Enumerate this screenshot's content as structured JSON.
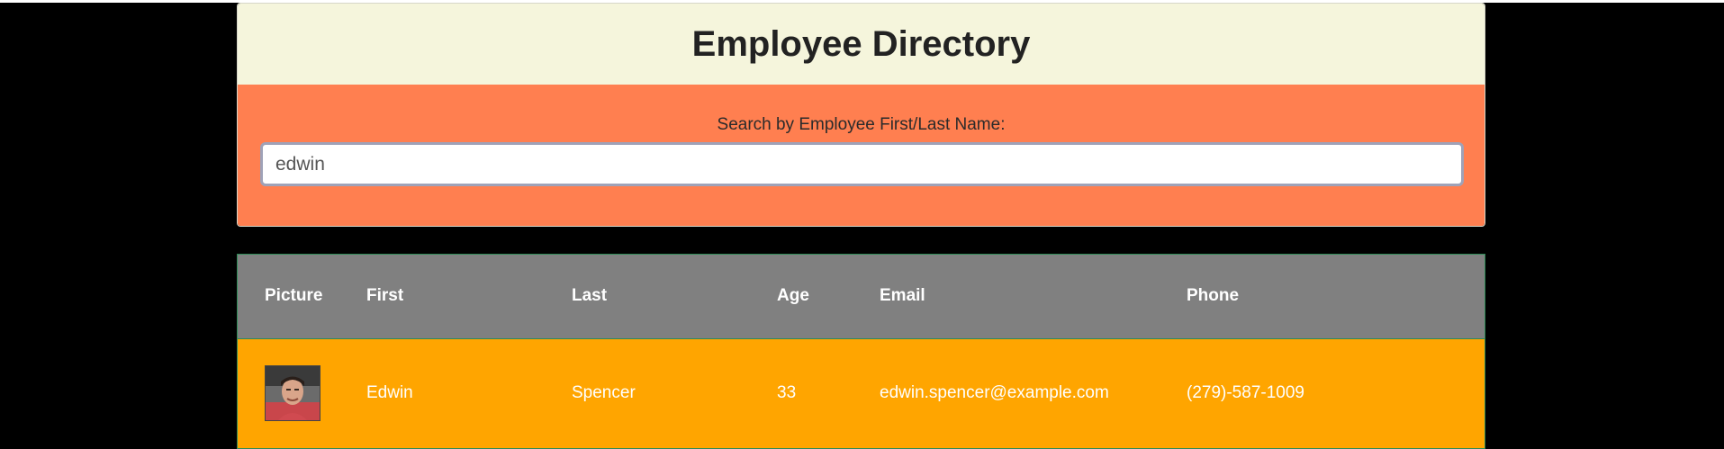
{
  "header": {
    "title": "Employee Directory"
  },
  "search": {
    "label": "Search by Employee First/Last Name:",
    "value": "edwin",
    "placeholder": ""
  },
  "table": {
    "columns": [
      "Picture",
      "First",
      "Last",
      "Age",
      "Email",
      "Phone"
    ],
    "rows": [
      {
        "picture": "employee-photo",
        "first": "Edwin",
        "last": "Spencer",
        "age": "33",
        "email": "edwin.spencer@example.com",
        "phone": "(279)-587-1009"
      }
    ]
  },
  "colors": {
    "background": "#000000",
    "title_bar": "#f5f5dc",
    "search_area": "#ff7f50",
    "table_header": "#808080",
    "table_row": "#ffa500",
    "table_border": "#2e8b57"
  }
}
